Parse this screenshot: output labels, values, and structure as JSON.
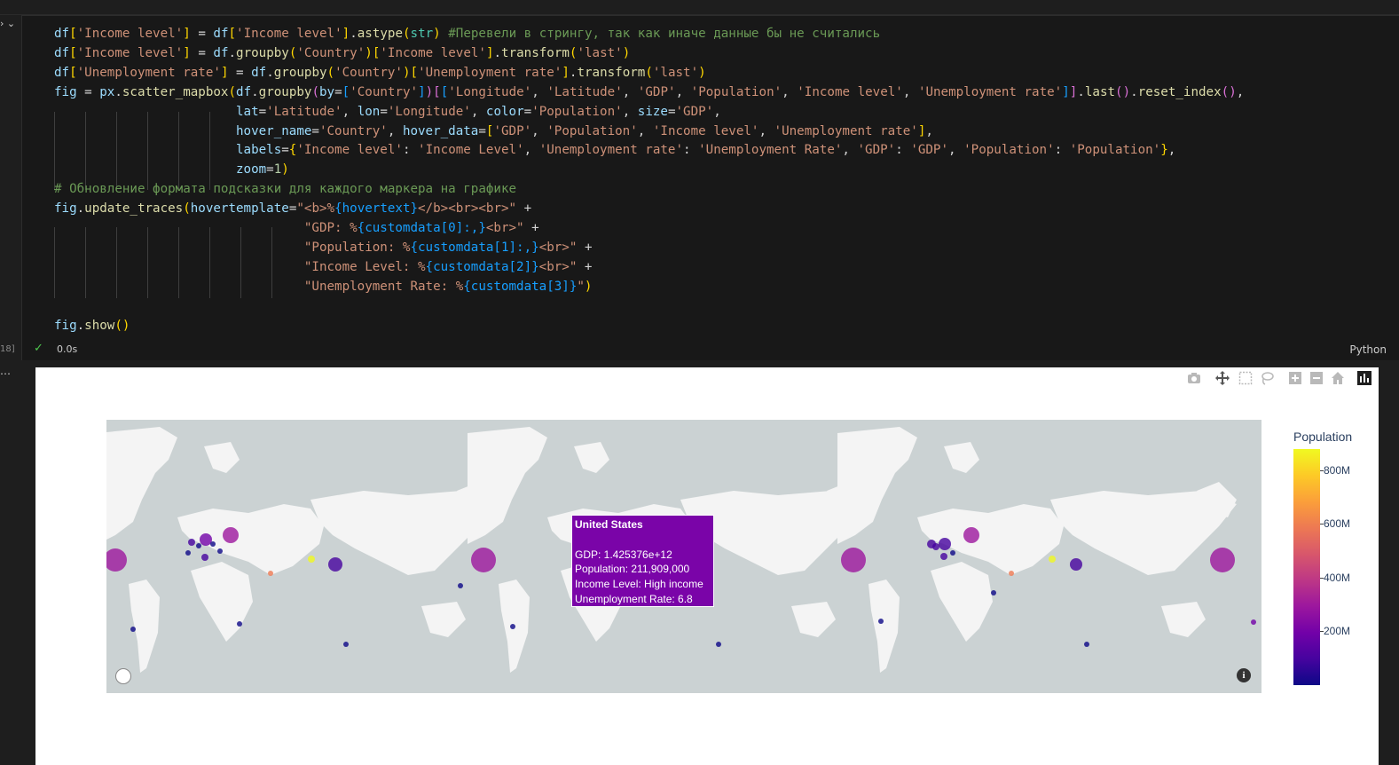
{
  "notebook": {
    "exec_count_label": "18]",
    "output_prompt": "…",
    "cell": {
      "status_icon": "check-icon",
      "exec_time": "0.0s",
      "language": "Python",
      "code_lines": [
        "df['Income level'] = df['Income level'].astype(str) #Перевели в стрингу, так как иначе данные бы не считались",
        "df['Income level'] = df.groupby('Country')['Income level'].transform('last')",
        "df['Unemployment rate'] = df.groupby('Country')['Unemployment rate'].transform('last')",
        "fig = px.scatter_mapbox(df.groupby(by=['Country'])[['Longitude', 'Latitude', 'GDP', 'Population', 'Income level', 'Unemployment rate']].last().reset_index(),",
        "                        lat='Latitude', lon='Longitude', color='Population', size='GDP',",
        "                        hover_name='Country', hover_data=['GDP', 'Population', 'Income level', 'Unemployment rate'],",
        "                        labels={'Income level': 'Income Level', 'Unemployment rate': 'Unemployment Rate', 'GDP': 'GDP', 'Population': 'Population'},",
        "                        zoom=1)",
        "# Обновление формата подсказки для каждого маркера на графике",
        "fig.update_traces(hovertemplate=\"<b>%{hovertext}</b><br><br>\" +",
        "                                 \"GDP: %{customdata[0]:,}<br>\" +",
        "                                 \"Population: %{customdata[1]:,}<br>\" +",
        "                                 \"Income Level: %{customdata[2]}<br>\" +",
        "                                 \"Unemployment Rate: %{customdata[3]}\")",
        "",
        "fig.show()"
      ]
    }
  },
  "plot": {
    "modebar_icons": [
      "camera-icon",
      "pan-icon",
      "box-select-icon",
      "lasso-icon",
      "zoom-in-icon",
      "zoom-out-icon",
      "reset-home-icon",
      "plotly-logo-icon"
    ],
    "tooltip": {
      "name": "United States",
      "gdp": "GDP: 1.425376e+12",
      "population": "Population: 211,909,000",
      "income": "Income Level: High income",
      "unemployment": "Unemployment Rate: 6.8"
    },
    "map_icons": [
      "mapbox-logo-icon",
      "info-icon"
    ],
    "colorbar": {
      "title": "Population",
      "ticks": [
        "800M",
        "600M",
        "400M",
        "200M"
      ],
      "tick_values": [
        800000000,
        600000000,
        400000000,
        200000000
      ],
      "colorscale": [
        "#f0f921",
        "#fdca26",
        "#fb9f3a",
        "#ed7953",
        "#d8576b",
        "#bd3786",
        "#9c179e",
        "#7201a8",
        "#46039f",
        "#0d0887"
      ]
    }
  },
  "chart_data": {
    "type": "scatter",
    "title": "",
    "xlabel": "",
    "ylabel": "",
    "marker_color_variable": "Population",
    "marker_size_variable": "GDP",
    "hovered_point": {
      "name": "United States",
      "GDP": 1425376000000,
      "Population": 211909000,
      "Income Level": "High income",
      "Unemployment Rate": 6.8
    },
    "colorbar_range": [
      0,
      880000000
    ]
  }
}
